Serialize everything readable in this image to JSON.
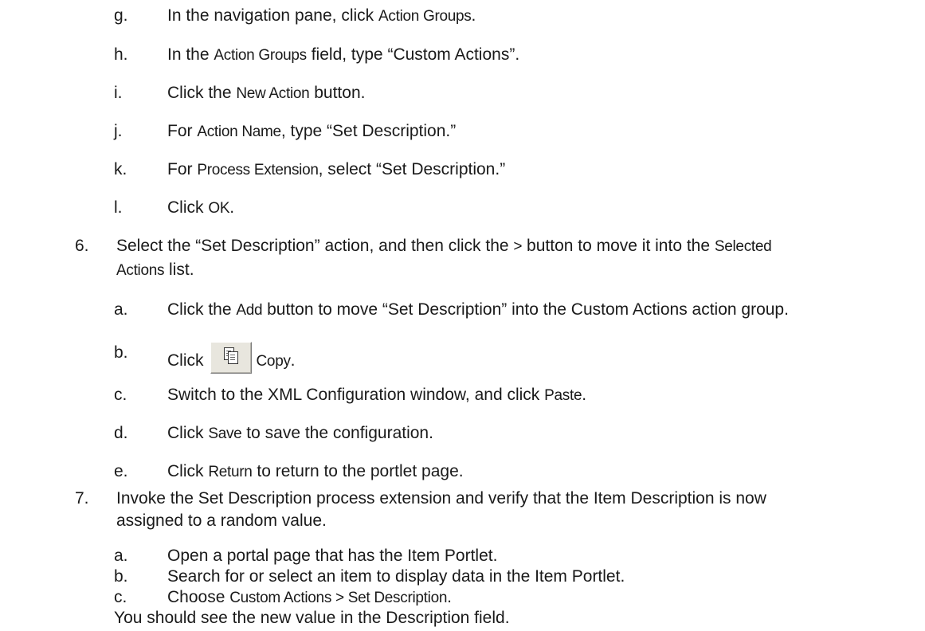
{
  "steps": {
    "g": {
      "marker": "g.",
      "pre": "In the navigation pane, click ",
      "ui": "Action Groups",
      "post": "."
    },
    "h": {
      "marker": "h.",
      "pre": "In the ",
      "ui": "Action Groups",
      "post": " field, type “Custom Actions”."
    },
    "i": {
      "marker": "i.",
      "pre": "Click the ",
      "ui": "New Action",
      "post": " button."
    },
    "j": {
      "marker": "j.",
      "pre": "For ",
      "ui": "Action Name",
      "post": ", type “Set Description.”"
    },
    "k": {
      "marker": "k.",
      "pre": "For ",
      "ui": "Process Extension",
      "post": ", select “Set Description.”"
    },
    "l": {
      "marker": "l.",
      "pre": "Click ",
      "ui": "OK",
      "post": "."
    },
    "s6": {
      "marker": "6.",
      "pre": "Select the “Set Description” action, and then click the ",
      "ui1": ">",
      "mid": " button to move it into the ",
      "ui2": "Selected",
      "cont_ui": "Actions",
      "cont_post": " list."
    },
    "s6a": {
      "marker": "a.",
      "pre": "Click the ",
      "ui": "Add",
      "post": " button to move “Set Description” into the Custom Actions action group."
    },
    "s6b": {
      "marker": "b.",
      "pre": "Click",
      "icon": "copy-icon",
      "ui": "Copy",
      "post": "."
    },
    "s6c": {
      "marker": "c.",
      "pre": "Switch to the XML Configuration window, and click ",
      "ui": "Paste",
      "post": "."
    },
    "s6d": {
      "marker": "d.",
      "pre": "Click ",
      "ui": "Save",
      "post": " to save the configuration."
    },
    "s6e": {
      "marker": "e.",
      "pre": "Click ",
      "ui": "Return",
      "post": " to return to the portlet page."
    },
    "s7": {
      "marker": "7.",
      "line1": "Invoke the Set Description process extension and verify that the Item Description is now",
      "line2": "assigned to a random value."
    },
    "s7a": {
      "marker": "a.",
      "text": "Open a portal page that has the Item Portlet."
    },
    "s7b": {
      "marker": "b.",
      "text": "Search for or select an item to display data in the Item Portlet."
    },
    "s7c": {
      "marker": "c.",
      "pre": "Choose ",
      "ui": "Custom Actions > Set Description",
      "post": "."
    },
    "result": "You should see the new value in the Description field."
  }
}
